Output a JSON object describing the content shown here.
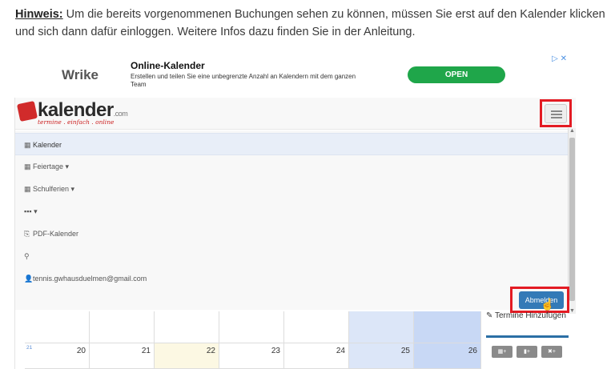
{
  "hint": {
    "label": "Hinweis:",
    "text": " Um die bereits vorgenommenen Buchungen sehen zu können, müssen Sie erst auf den Kalender klicken und sich dann dafür einloggen. Weitere Infos dazu finden Sie in der Anleitung."
  },
  "ad": {
    "logo": "Wrike",
    "title": "Online-Kalender",
    "description": "Erstellen und teilen Sie eine unbegrenzte Anzahl an Kalendern mit dem ganzen Team",
    "open_label": "OPEN",
    "adchoice": "▷ ✕"
  },
  "brand": {
    "name": "kalender",
    "suffix": ".com",
    "tagline": "termine . einfach . online"
  },
  "menu": {
    "items": [
      {
        "icon": "▦",
        "label": "Kalender"
      },
      {
        "icon": "▦",
        "label": "Feiertage ▾"
      },
      {
        "icon": "▦",
        "label": "Schulferien ▾"
      },
      {
        "icon": "",
        "label": "▪▪▪ ▾"
      },
      {
        "icon": "⎘",
        "label": "PDF-Kalender"
      },
      {
        "icon": "⚲",
        "label": ""
      },
      {
        "icon": "👤",
        "label": "tennis.gwhausduelmen@gmail.com"
      }
    ],
    "logout_label": "Abmelden"
  },
  "calendar": {
    "week": "21",
    "days": [
      "20",
      "21",
      "22",
      "23",
      "24",
      "25",
      "26"
    ]
  },
  "side": {
    "termin_label": "✎ Termine Hinzufügen",
    "btn1": "▦+",
    "btn2": "▮+",
    "btn3": "✖+"
  },
  "colors": {
    "highlight": "#e31b23",
    "primary": "#337ab7",
    "today": "#fcf8e3",
    "weekend": "#dce6f8",
    "weekend_alt": "#c8d8f5"
  }
}
